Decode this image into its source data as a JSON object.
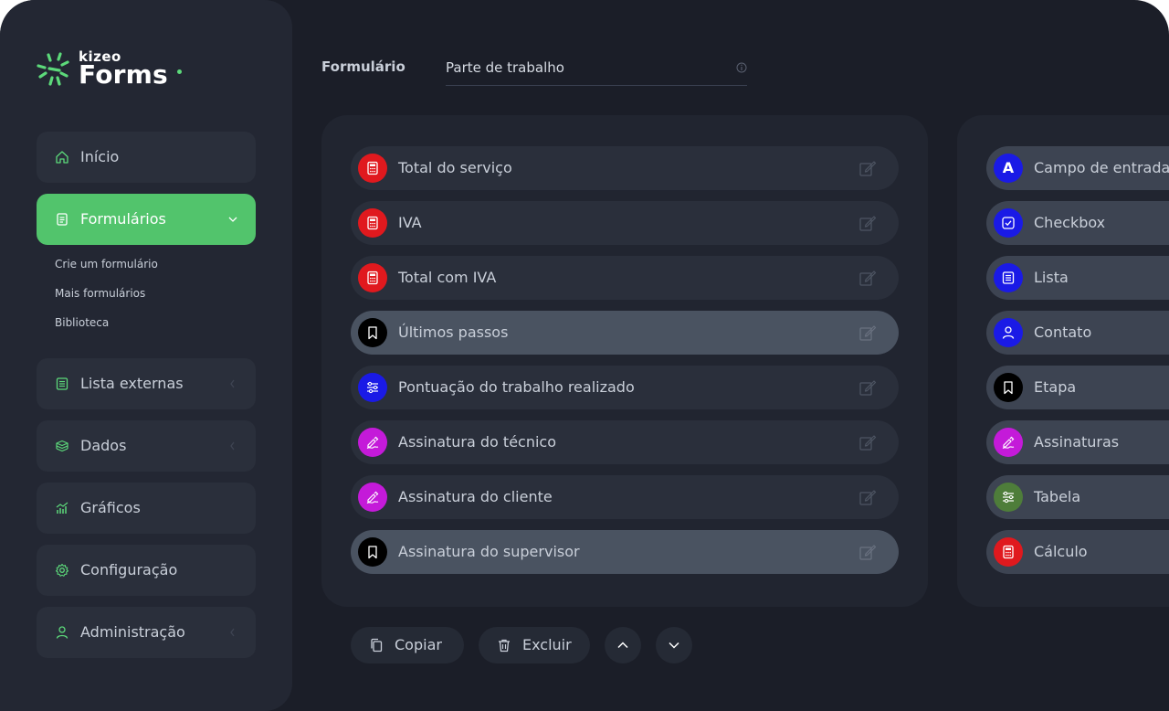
{
  "brand": {
    "small": "kizeo",
    "big": "Forms",
    "color": "#5cd97a"
  },
  "sidebar": {
    "items": [
      {
        "label": "Início",
        "icon": "home-icon"
      },
      {
        "label": "Formulários",
        "icon": "document-icon",
        "active": true,
        "expanded": true
      },
      {
        "label": "Lista externas",
        "icon": "list-icon"
      },
      {
        "label": "Dados",
        "icon": "database-icon"
      },
      {
        "label": "Gráficos",
        "icon": "bar-chart-icon"
      },
      {
        "label": "Configuração",
        "icon": "gear-icon"
      },
      {
        "label": "Administração",
        "icon": "user-icon"
      }
    ],
    "subitems": [
      "Crie um formulário",
      "Mais formulários",
      "Biblioteca"
    ]
  },
  "header": {
    "form_label": "Formulário",
    "form_value": "Parte de trabalho"
  },
  "fields": [
    {
      "label": "Total do serviço",
      "icon": "calculator-icon",
      "color": "#e0191e"
    },
    {
      "label": "IVA",
      "icon": "calculator-icon",
      "color": "#e0191e"
    },
    {
      "label": "Total com IVA",
      "icon": "calculator-icon",
      "color": "#e0191e"
    },
    {
      "label": "Últimos passos",
      "icon": "bookmark-icon",
      "color": "#000000",
      "highlighted": true
    },
    {
      "label": "Pontuação do trabalho realizado",
      "icon": "sliders-icon",
      "color": "#1a1ae6"
    },
    {
      "label": "Assinatura do técnico",
      "icon": "signature-icon",
      "color": "#c41ad9"
    },
    {
      "label": "Assinatura do cliente",
      "icon": "signature-icon",
      "color": "#c41ad9"
    },
    {
      "label": "Assinatura do supervisor",
      "icon": "bookmark-icon",
      "color": "#000000",
      "highlighted": true
    }
  ],
  "types": [
    {
      "label": "Campo de entrada",
      "icon": "text-a-icon",
      "color": "#1a1ae6",
      "glyph": "A"
    },
    {
      "label": "Checkbox",
      "icon": "checkbox-icon",
      "color": "#1a1ae6"
    },
    {
      "label": "Lista",
      "icon": "list-icon",
      "color": "#1a1ae6"
    },
    {
      "label": "Contato",
      "icon": "user-icon",
      "color": "#1a1ae6"
    },
    {
      "label": "Etapa",
      "icon": "bookmark-icon",
      "color": "#000000"
    },
    {
      "label": "Assinaturas",
      "icon": "signature-icon",
      "color": "#c41ad9"
    },
    {
      "label": "Tabela",
      "icon": "sliders-icon",
      "color": "#4e7d3a"
    },
    {
      "label": "Cálculo",
      "icon": "calculator-icon",
      "color": "#e0191e"
    }
  ],
  "toolbar": {
    "copy_label": "Copiar",
    "delete_label": "Excluir"
  },
  "colors": {
    "accent": "#52c46c",
    "background": "#1b1e28",
    "sidebar": "#232733"
  }
}
